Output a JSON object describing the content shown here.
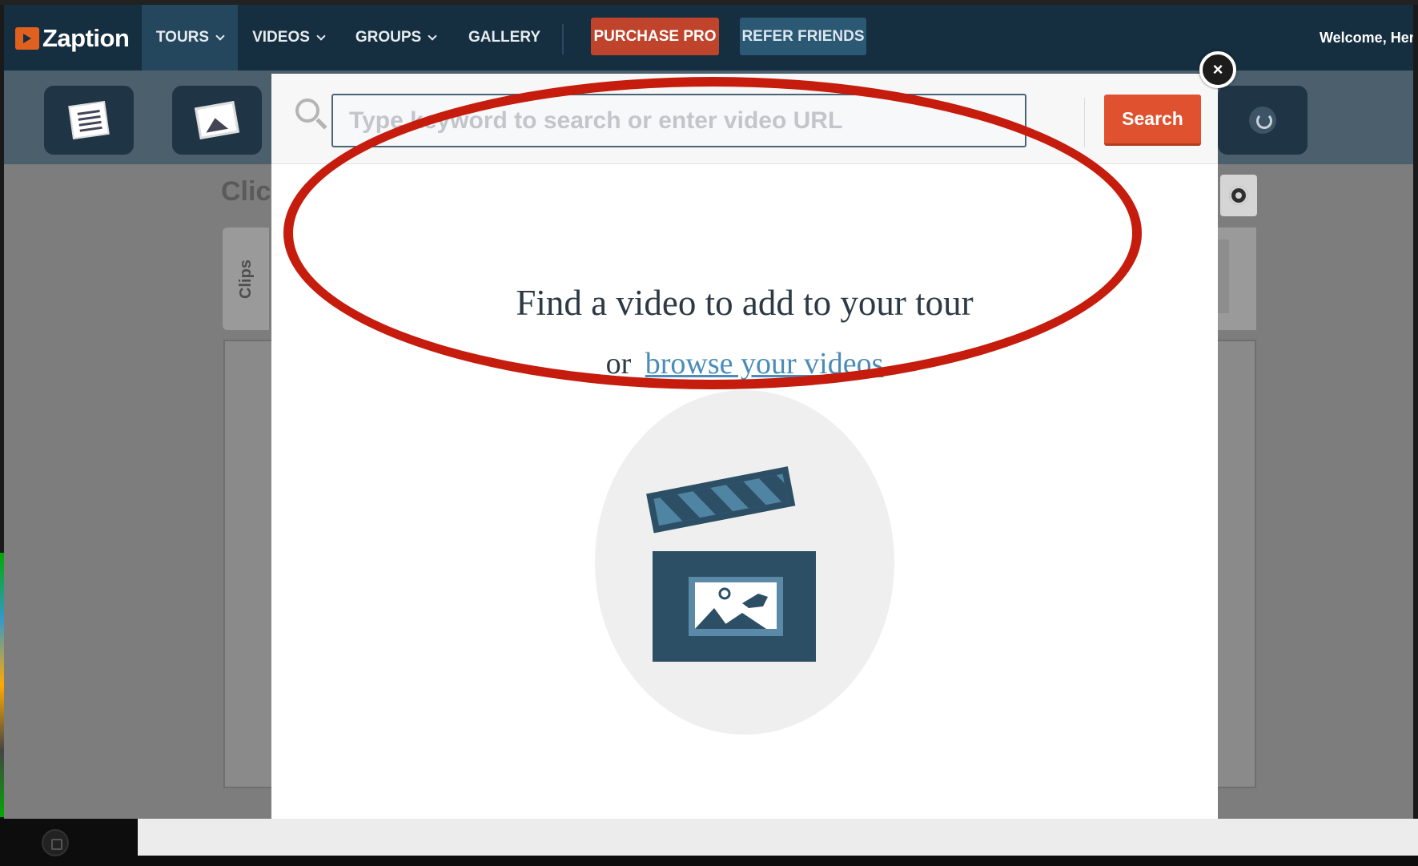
{
  "brand": {
    "name": "Zaption"
  },
  "nav": {
    "items": [
      {
        "label": "TOURS",
        "has_dropdown": true,
        "active": true
      },
      {
        "label": "VIDEOS",
        "has_dropdown": true,
        "active": false
      },
      {
        "label": "GROUPS",
        "has_dropdown": true,
        "active": false
      },
      {
        "label": "GALLERY",
        "has_dropdown": false,
        "active": false
      }
    ],
    "purchase_label": "PURCHASE PRO",
    "refer_label": "REFER FRIENDS",
    "welcome_text": "Welcome, Hen"
  },
  "toolbar": {
    "buttons": [
      {
        "icon": "text-slide-icon"
      },
      {
        "icon": "image-slide-icon"
      },
      {
        "icon": "refresh-icon"
      }
    ]
  },
  "background": {
    "title_fragment": "Clic",
    "clips_tab": "Clips"
  },
  "modal": {
    "search_placeholder": "Type keyword to search or enter video URL",
    "search_value": "",
    "search_button": "Search",
    "close_symbol": "×",
    "heading": "Find a video to add to your tour",
    "browse_prefix": "or",
    "browse_link": "browse your videos",
    "illustration": "clapperboard-icon"
  },
  "colors": {
    "nav_bg": "#152f40",
    "accent_orange": "#e0522f",
    "purchase_red": "#c0432c",
    "link_blue": "#4a8cb9",
    "annotation_red": "#c51c0d"
  }
}
